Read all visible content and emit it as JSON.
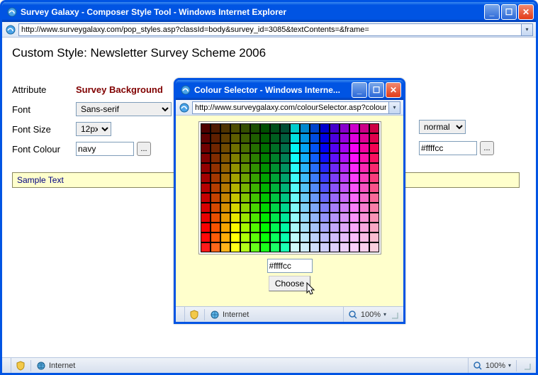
{
  "mainWindow": {
    "title": "Survey Galaxy - Composer Style Tool - Windows Internet Explorer",
    "url": "http://www.surveygalaxy.com/pop_styles.asp?classId=body&survey_id=3085&textContents=&frame="
  },
  "page": {
    "heading": "Custom Style: Newsletter Survey Scheme 2006",
    "labels": {
      "attribute": "Attribute",
      "attributeValue": "Survey Background",
      "font": "Font",
      "fontSize": "Font Size",
      "fontColour": "Font Colour"
    },
    "fields": {
      "fontValue": "Sans-serif",
      "fontSizeValue": "12px",
      "fontColourValue": "navy",
      "fontWeightValue": "normal",
      "bgColourValue": "#ffffcc"
    },
    "sampleText": "Sample Text",
    "ellipsis": "..."
  },
  "popup": {
    "title": "Colour Selector - Windows Interne...",
    "url": "http://www.surveygalaxy.com/colourSelector.asp?colour",
    "selectedColor": "#ffffcc",
    "chooseLabel": "Choose"
  },
  "statusbar": {
    "zone": "Internet",
    "zoom": "100%"
  },
  "colorGridRows": 13,
  "colorGridCols": 18
}
